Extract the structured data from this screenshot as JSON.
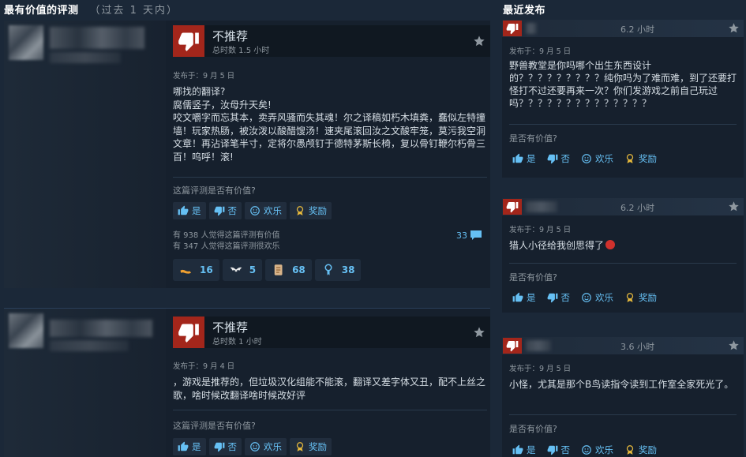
{
  "left_header": {
    "title": "最有价值的评测",
    "subtitle": "（过去 1 天内）"
  },
  "right_header": {
    "title": "最近发布"
  },
  "vote_labels": {
    "yes": "是",
    "no": "否",
    "funny": "欢乐",
    "award": "奖励"
  },
  "colors": {
    "not_recommended": "#a3261b",
    "link": "#66c0f4",
    "background": "#1b2838"
  },
  "reviews": [
    {
      "verdict": "不推荐",
      "hours": "总时数 1.5 小时",
      "posted": "发布于：9 月 5 日",
      "text": "哪找的翻译?\n腐儒竖子，汝母升天矣!\n咬文嚼字而忘其本，卖弄风骚而失其魂！尔之译稿如朽木填粪，蠢似左特撞墙！玩家热肠，被汝泼以酸醋馊汤！速夹尾滚回汝之文酸牢笼，莫污我空洞文章！再沾译笔半寸，定将尔愚颅钉于德特茅斯长椅，复以骨钉鞭尔朽骨三百！呜呼！滚!",
      "question": "这篇评测是否有价值?",
      "helpful_stat": "有 938 人觉得这篇评测有价值",
      "funny_stat": "有 347 人觉得这篇评测很欢乐",
      "comments": "33",
      "awards": [
        {
          "icon": "flexed-arm-icon",
          "count": "16"
        },
        {
          "icon": "wings-icon",
          "count": "5"
        },
        {
          "icon": "scroll-icon",
          "count": "68"
        },
        {
          "icon": "medal-icon",
          "count": "38"
        }
      ]
    },
    {
      "verdict": "不推荐",
      "hours": "总时数 1 小时",
      "posted": "发布于：9 月 4 日",
      "text": "，游戏是推荐的，但垃圾汉化组能不能滚，翻译又差字体又丑，配不上丝之歌，啥时候改翻译啥时候改好评",
      "question": "这篇评测是否有价值?"
    }
  ],
  "recent": [
    {
      "hours": "6.2 小时",
      "posted": "发布于：9 月 5 日",
      "text": "野兽教堂是你吗哪个出生东西设计的？？？？？？？？？纯你吗为了难而难，到了还要打怪打不过还要再来一次？你们发游戏之前自己玩过吗？？？？？？？？？？？？？？",
      "question": "是否有价值?"
    },
    {
      "hours": "6.2 小时",
      "posted": "发布于：9 月 5 日",
      "text": "猎人小径给我创思得了",
      "question": "是否有价值?"
    },
    {
      "hours": "3.6 小时",
      "posted": "发布于：9 月 5 日",
      "text": "小怪，尤其是那个B鸟读指令读到工作室全家死光了。",
      "question": "是否有价值?"
    }
  ]
}
